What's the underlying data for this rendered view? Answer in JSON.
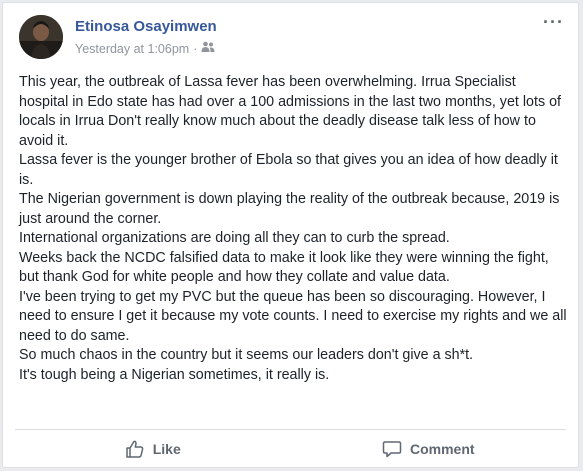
{
  "post": {
    "author": "Etinosa Osayimwen",
    "timestamp": "Yesterday at 1:06pm",
    "separator": "·",
    "audience_icon": "friends-icon",
    "more_icon": "ellipsis-icon",
    "more_label": "···",
    "paragraphs": [
      "This year, the outbreak of Lassa fever has been overwhelming. Irrua Specialist hospital in Edo state has had over a 100 admissions in the last two months, yet lots of locals in Irrua Don't really know much about the deadly disease talk less of how to avoid it.",
      "Lassa fever is the younger brother of Ebola so that gives you an idea of how deadly it is.",
      "The Nigerian government is down playing the reality of the outbreak because, 2019 is just around the corner.",
      "International organizations are doing all they can to curb the spread.",
      "Weeks back the NCDC falsified data to make it look like they were winning the fight, but thank God for white people and how they collate and value data.",
      "I've been trying to get my PVC but the queue has been so discouraging. However, I need to ensure I get it because my vote counts. I need to exercise my rights and we all need to do same.",
      "So much chaos in the country but it seems our leaders don't give a sh*t.",
      "It's tough being a Nigerian sometimes, it really is."
    ]
  },
  "actions": {
    "like_label": "Like",
    "like_icon": "thumbs-up-icon",
    "comment_label": "Comment",
    "comment_icon": "comment-bubble-icon"
  },
  "colors": {
    "author_link": "#365899",
    "body_text": "#1d2129",
    "meta_text": "#90949c",
    "action_text": "#606770"
  }
}
